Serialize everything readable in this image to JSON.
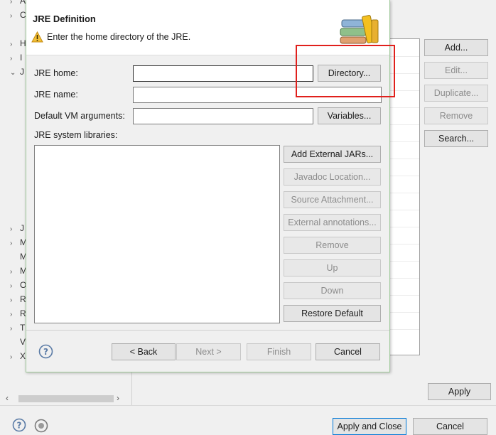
{
  "background": {
    "tree": [
      {
        "chevron": "›",
        "label": "A"
      },
      {
        "chevron": "›",
        "label": "C"
      },
      {
        "chevron": "›",
        "label": "H"
      },
      {
        "chevron": "›",
        "label": "I"
      },
      {
        "chevron": "⌄",
        "label": "J"
      },
      {
        "chevron": "›",
        "label": "J"
      },
      {
        "chevron": "›",
        "label": "M"
      },
      {
        "chevron": "",
        "label": "M"
      },
      {
        "chevron": "›",
        "label": "M"
      },
      {
        "chevron": "›",
        "label": "O"
      },
      {
        "chevron": "›",
        "label": "R"
      },
      {
        "chevron": "›",
        "label": "R"
      },
      {
        "chevron": "›",
        "label": "T"
      },
      {
        "chevron": "",
        "label": "V"
      },
      {
        "chevron": "›",
        "label": "X"
      }
    ],
    "buttons": {
      "add": "Add...",
      "edit": "Edit...",
      "duplicate": "Duplicate...",
      "remove": "Remove",
      "search": "Search...",
      "apply": "Apply",
      "apply_and_close": "Apply and Close",
      "cancel": "Cancel"
    }
  },
  "dialog": {
    "title": "JRE Definition",
    "message": "Enter the home directory of the JRE.",
    "fields": {
      "jre_home_label": "JRE home:",
      "jre_home_value": "",
      "jre_name_label": "JRE name:",
      "jre_name_value": "",
      "vm_args_label": "Default VM arguments:",
      "vm_args_value": "",
      "sys_libs_label": "JRE system libraries:"
    },
    "buttons": {
      "directory": "Directory...",
      "variables": "Variables...",
      "add_external_jars": "Add External JARs...",
      "javadoc_location": "Javadoc Location...",
      "source_attachment": "Source Attachment...",
      "external_annotations": "External annotations...",
      "remove": "Remove",
      "up": "Up",
      "down": "Down",
      "restore_default": "Restore Default",
      "back": "< Back",
      "next": "Next >",
      "finish": "Finish",
      "cancel": "Cancel"
    }
  },
  "colors": {
    "highlight": "#e0201c",
    "dialog_border": "#9fc99a",
    "warning": "#f2c037"
  },
  "icons": [
    "warning-icon",
    "jre-books-icon",
    "help-icon",
    "settings-icon",
    "chevron-left-icon",
    "chevron-right-icon"
  ]
}
